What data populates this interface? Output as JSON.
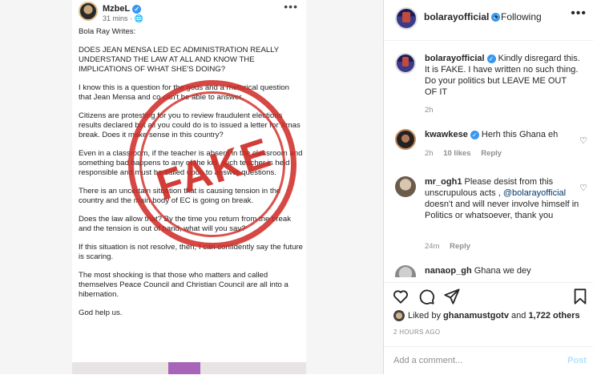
{
  "facebook_post": {
    "author": "MzbeL",
    "time": "31 mins",
    "more": "•••",
    "paragraphs": [
      "Bola Ray Writes:",
      "DOES JEAN MENSA LED EC ADMINISTRATION REALLY UNDERSTAND THE LAW AT ALL AND KNOW THE IMPLICATIONS OF WHAT SHE'S DOING?",
      "I know this is a question for the gods and a rhetorical question that Jean Mensa and co can't be able to answer.",
      "Citizens are protesting for you to review fraudulent elections results declared but all you could do is to issued a letter for Xmas break. Does it make sense in this country?",
      "Even in a classroom, if the teacher is absent in the classroom and something bad happens to any of the kid, such teacher is held responsible and must be called upon to answer questions.",
      "There is an uncertain situation that is causing tension in the country and the main body of EC is going on break.",
      "Does the law allow that? By the time you return from the break and the tension is out of hand, what will you say?",
      "If this situation is not resolve, then, I can confidently say the future is scaring.",
      "The most shocking is that those who matters and called themselves Peace Council and Christian Council are all into a hibernation.",
      "God help us."
    ],
    "stamp_text": "FAKE"
  },
  "header": {
    "username": "bolarayofficial",
    "dot": "•",
    "follow_status": "Following",
    "more": "•••"
  },
  "comments": [
    {
      "username": "bolarayofficial",
      "text": "Kindly disregard this. It is FAKE. I have written no such thing. Do your politics but LEAVE ME OUT OF IT",
      "time": "2h"
    },
    {
      "username": "kwawkese",
      "text": "Herh this Ghana eh",
      "time": "2h",
      "likes": "10 likes",
      "reply": "Reply"
    },
    {
      "username": "mr_ogh1",
      "text_before": "Please desist from this unscrupulous acts ,",
      "mention": "@bolarayofficial",
      "text_after": "doesn't and will never involve himself in Politics or whatsoever, thank you",
      "time": "24m",
      "reply": "Reply"
    },
    {
      "username": "nanaop_gh",
      "text": "Ghana we dey"
    }
  ],
  "likes": {
    "prefix": "Liked by",
    "user": "ghanamustgotv",
    "middle": "and",
    "count": "1,722 others"
  },
  "posted_ago": "2 HOURS AGO",
  "add_comment": {
    "placeholder": "Add a comment...",
    "post_label": "Post"
  },
  "colors": {
    "verified": "#3897f0",
    "stamp": "#ce2822",
    "post_button": "#b2dffc",
    "meta_text": "#8e8e8e"
  }
}
